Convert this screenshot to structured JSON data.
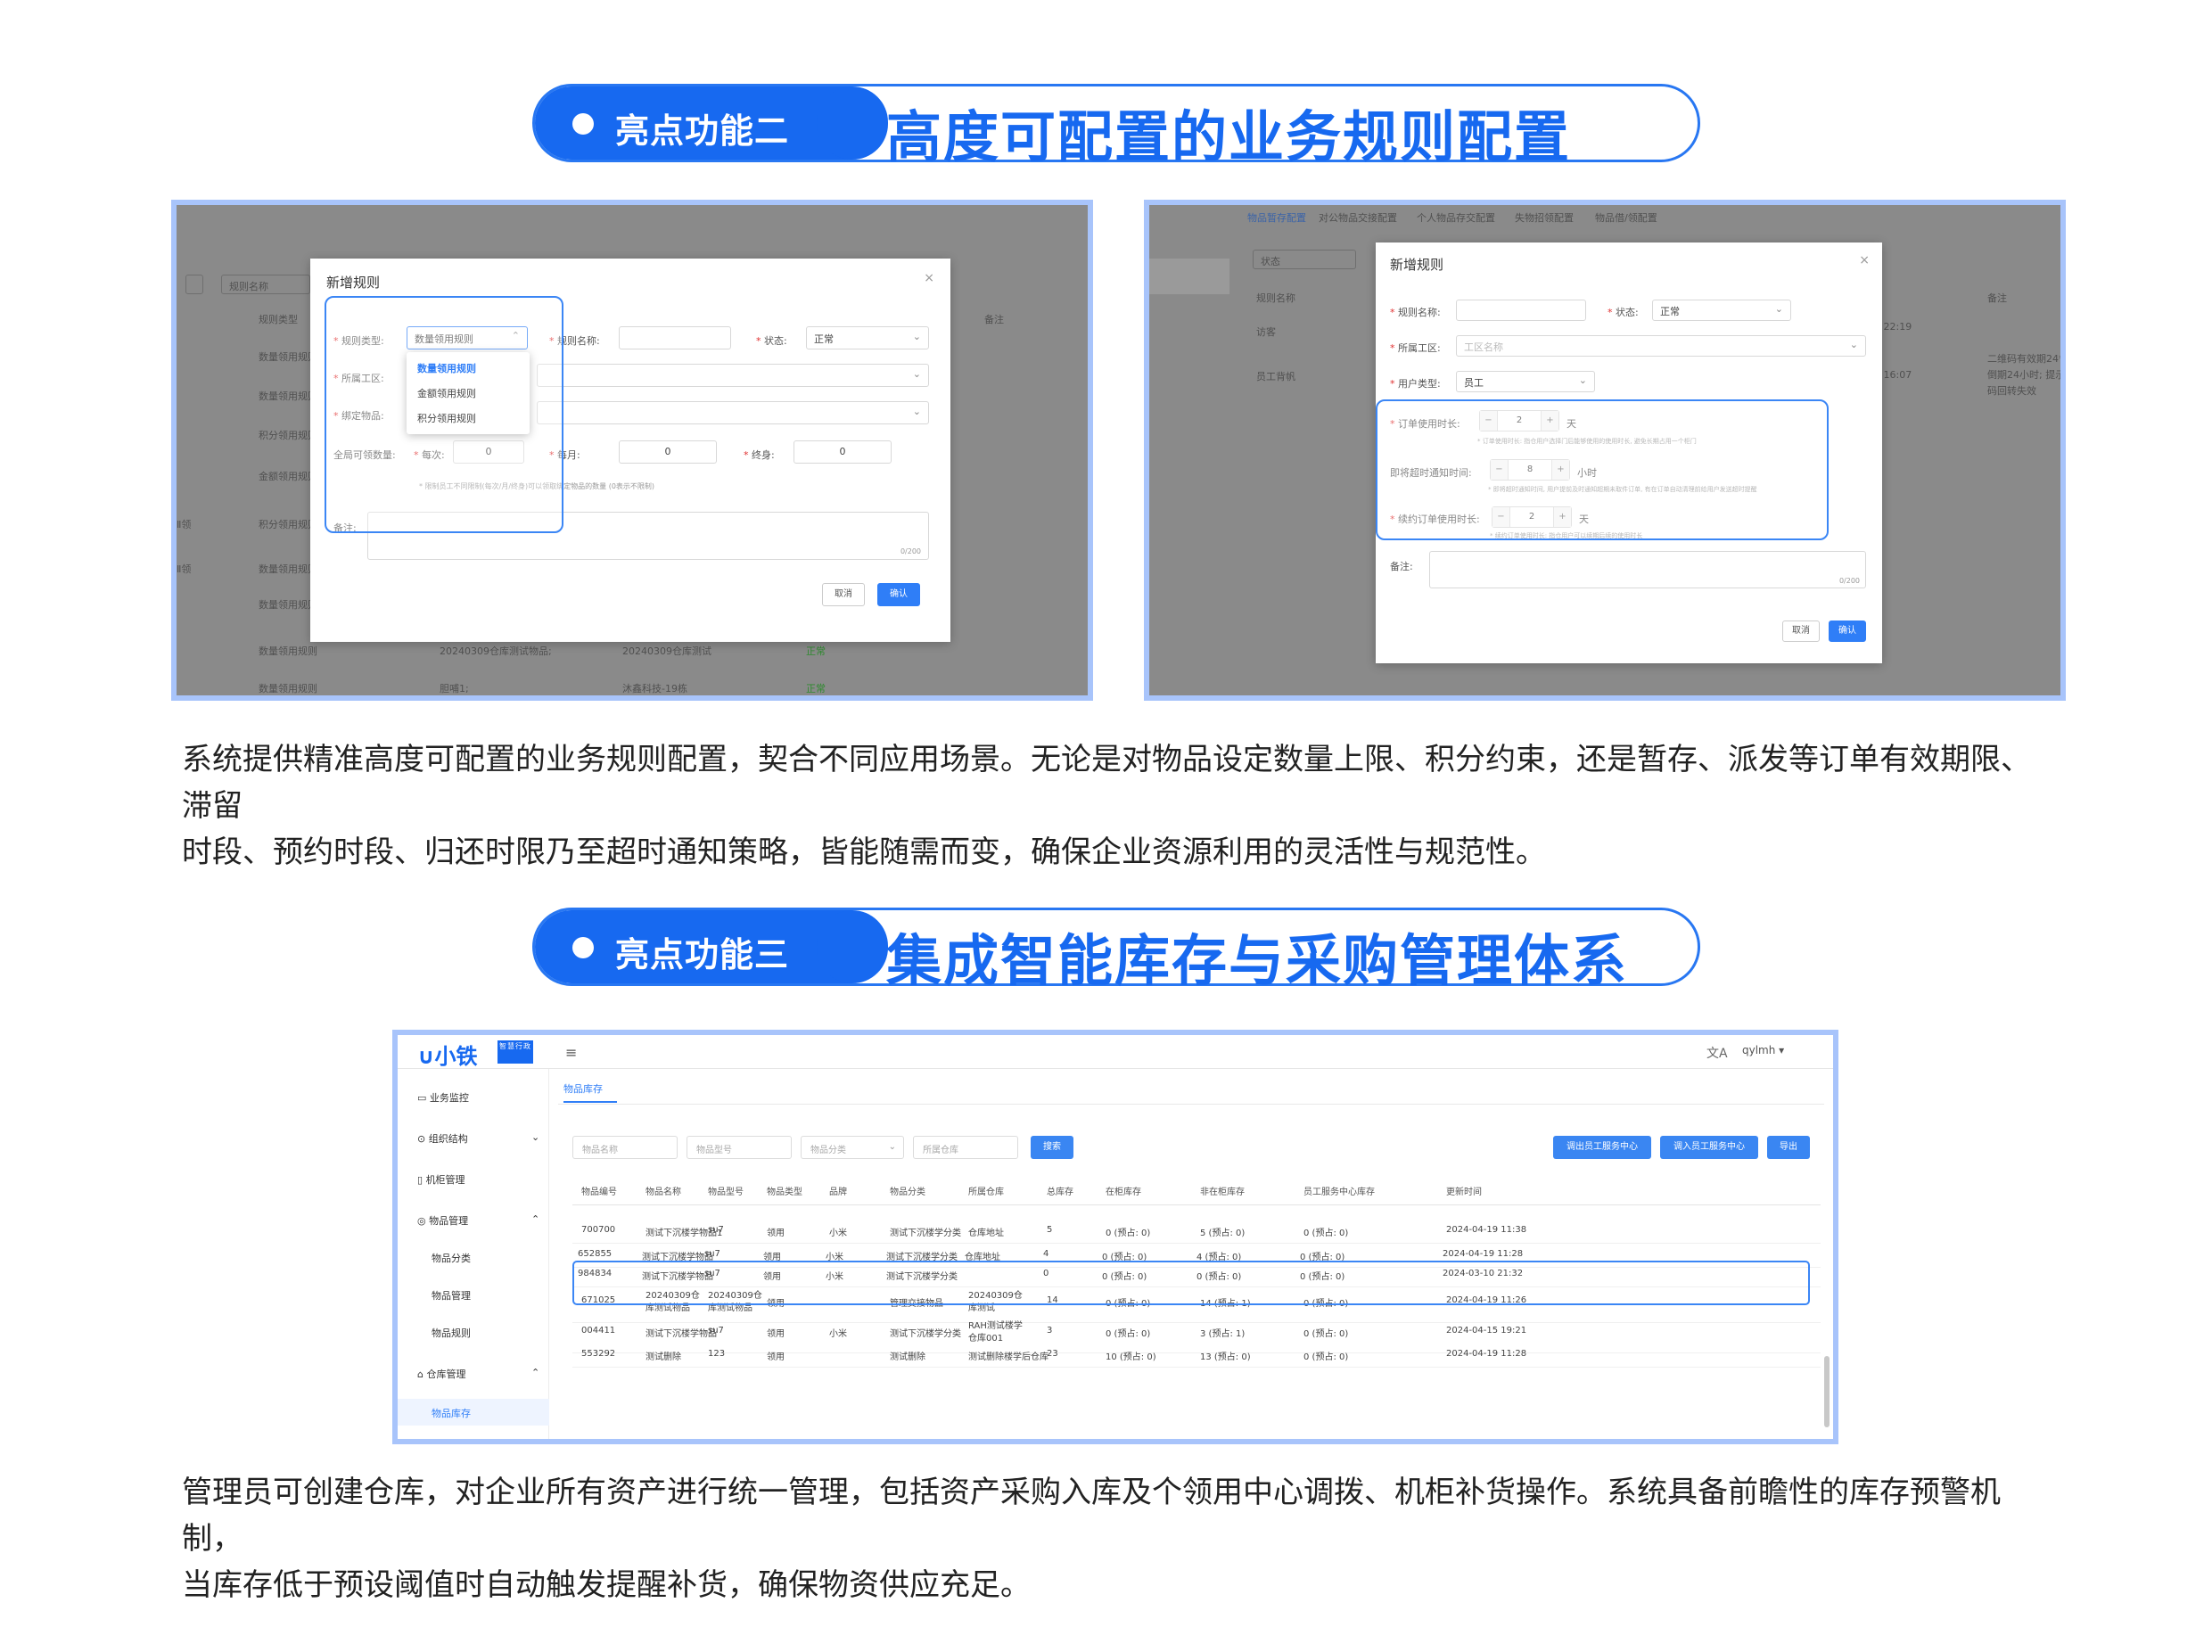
{
  "section2": {
    "tag": "亮点功能二",
    "title": "高度可配置的业务规则配置"
  },
  "para2_l1": "系统提供精准高度可配置的业务规则配置，契合不同应用场景。无论是对物品设定数量上限、积分约束，还是暂存、派发等订单有效期限、滞留",
  "para2_l2": "时段、预约时段、归还时限乃至超时通知策略，皆能随需而变，确保企业资源利用的灵活性与规范性。",
  "section3": {
    "tag": "亮点功能三",
    "title": "集成智能库存与采购管理体系"
  },
  "para3_l1": "管理员可创建仓库，对企业所有资产进行统一管理，包括资产采购入库及个领用中心调拨、机柜补货操作。系统具备前瞻性的库存预警机制，",
  "para3_l2": "当库存低于预设阈值时自动触发提醒补货，确保物资供应充足。",
  "shot1": {
    "bg": {
      "search_ph": "规则名称",
      "col_type": "规则类型",
      "col_note": "备注",
      "rows": [
        "数量领用规则",
        "数量领用规则",
        "积分领用规则",
        "金额领用规则",
        "积分领用规则",
        "数量领用规则",
        "数量领用规则",
        "数量领用规则",
        "数量领用规则"
      ],
      "row_c2": "20240309仓库测试物品;",
      "row_c3": "20240309仓库测试",
      "row_status": "正常",
      "row2_c2": "胆哺1;",
      "row2_c3": "沐鑫科技-19栋",
      "left_a": "Ⅱ领",
      "left_b": "Ⅱ领"
    },
    "modal": {
      "title": "新增规则",
      "close": "×",
      "type_label": "规则类型:",
      "type_value": "数量领用规则",
      "name_label": "规则名称:",
      "status_label": "状态:",
      "status_value": "正常",
      "area_label": "所属工区:",
      "item_label": "绑定物品:",
      "qty_label": "全局可领数量:",
      "each_label": "每次:",
      "each_val": "0",
      "month_label": "每月:",
      "month_val": "0",
      "life_label": "终身:",
      "life_val": "0",
      "hint": "* 限制员工不同限制(每次/月/终身)可以领取绑定物品的数量 (0表示不限制)",
      "note_label": "备注:",
      "counter": "0/200",
      "cancel": "取消",
      "ok": "确认",
      "options": [
        "数量领用规则",
        "金额领用规则",
        "积分领用规则"
      ]
    }
  },
  "shot2": {
    "tabs": [
      "物品暂存配置",
      "对公物品交接配置",
      "个人物品存交配置",
      "失物招领配置",
      "物品借/领配置"
    ],
    "bg": {
      "status_ph": "状态",
      "col_name": "规则名称",
      "col_note": "备注",
      "row1": "访客",
      "row2": "员工背帆",
      "time1": "28 22:19",
      "time2": "30 16:07",
      "note1": "二维码有效期24*6",
      "note2": "倒期24小时; 提示",
      "note3": "码回转失效"
    },
    "modal": {
      "title": "新增规则",
      "close": "×",
      "name_label": "规则名称:",
      "status_label": "状态:",
      "status_value": "正常",
      "area_label": "所属工区:",
      "area_ph": "工区名称",
      "user_label": "用户类型:",
      "user_value": "员工",
      "order_label": "订单使用时长:",
      "order_val": "2",
      "order_unit": "天",
      "order_hint": "* 订单使用时长: 指仓用户选择门后能够使用的使用时长, 避免长期占用一个柜门",
      "notify_label": "即将超时通知时间:",
      "notify_val": "8",
      "notify_unit": "小时",
      "notify_hint": "* 即将超时通知时间, 用户提前及时通知超期未取件订单, 有在订单自动清理前给用户发送超时提醒",
      "renew_label": "续约订单使用时长:",
      "renew_val": "2",
      "renew_unit": "天",
      "renew_hint": "* 续约订单使用时长: 指仓用户可以续期后续的使用时长",
      "note_label": "备注:",
      "counter": "0/200",
      "cancel": "取消",
      "ok": "确认"
    }
  },
  "shot3": {
    "logo": "小铁",
    "logo_sub": "智慧行政",
    "user": "qylmh",
    "tab": "物品库存",
    "sidebar": [
      "业务监控",
      "组织结构",
      "机柜管理",
      "物品管理",
      "物品分类",
      "物品管理",
      "物品规则",
      "仓库管理",
      "物品库存"
    ],
    "search": [
      "物品名称",
      "物品型号",
      "物品分类",
      "所属仓库"
    ],
    "search_btn": "搜索",
    "actions": [
      "调出员工服务中心",
      "调入员工服务中心",
      "导出"
    ],
    "headers": [
      "物品编号",
      "物品名称",
      "物品型号",
      "物品类型",
      "品牌",
      "物品分类",
      "所属仓库",
      "总库存",
      "在柜库存",
      "非在柜库存",
      "员工服务中心库存",
      "更新时间"
    ],
    "rows": [
      [
        "700700",
        "测试下沉楼学物品1",
        "su7",
        "领用",
        "小米",
        "测试下沉楼学分类",
        "仓库地址",
        "5",
        "0 (预占: 0)",
        "5 (预占: 0)",
        "0 (预占: 0)",
        "2024-04-19 11:38"
      ],
      [
        "652855",
        "测试下沉楼学物品",
        "su7",
        "领用",
        "小米",
        "测试下沉楼学分类",
        "仓库地址",
        "4",
        "0 (预占: 0)",
        "4 (预占: 0)",
        "0 (预占: 0)",
        "2024-04-19 11:28"
      ],
      [
        "984834",
        "测试下沉楼学物品",
        "su7",
        "领用",
        "小米",
        "测试下沉楼学分类",
        "",
        "0",
        "0 (预占: 0)",
        "0 (预占: 0)",
        "0 (预占: 0)",
        "2024-03-10 21:32"
      ],
      [
        "671025",
        "20240309仓库测试物品",
        "20240309仓库测试物品",
        "领用",
        "",
        "管理交接物品",
        "20240309仓库测试",
        "14",
        "0 (预占: 0)",
        "14 (预占: 1)",
        "0 (预占: 0)",
        "2024-04-19 11:26"
      ],
      [
        "004411",
        "测试下沉楼学物品",
        "su7",
        "领用",
        "小米",
        "测试下沉楼学分类",
        "RAH测试楼学仓库001",
        "3",
        "0 (预占: 0)",
        "3 (预占: 1)",
        "0 (预占: 0)",
        "2024-04-15 19:21"
      ],
      [
        "553292",
        "测试删除",
        "123",
        "领用",
        "",
        "测试删除",
        "测试删除楼学后仓库",
        "23",
        "10 (预占: 0)",
        "13 (预占: 0)",
        "0 (预占: 0)",
        "2024-04-19 11:28"
      ]
    ]
  },
  "colors": {
    "brand": "#1769f0",
    "frame": "#a8c4fb"
  }
}
